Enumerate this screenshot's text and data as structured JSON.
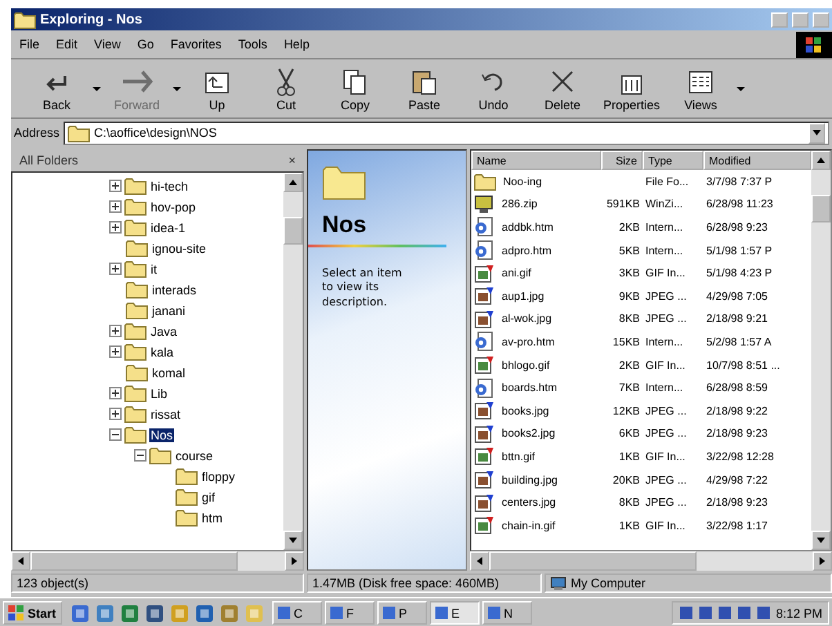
{
  "window": {
    "title": "Exploring - Nos"
  },
  "menu": [
    "File",
    "Edit",
    "View",
    "Go",
    "Favorites",
    "Tools",
    "Help"
  ],
  "toolbar": [
    {
      "label": "Back",
      "kind": "back",
      "disabled": false,
      "dropdown": true
    },
    {
      "label": "Forward",
      "kind": "forward",
      "disabled": true,
      "dropdown": true
    },
    {
      "label": "Up",
      "kind": "up",
      "disabled": false,
      "dropdown": false
    },
    {
      "label": "Cut",
      "kind": "cut",
      "disabled": false,
      "dropdown": false
    },
    {
      "label": "Copy",
      "kind": "copy",
      "disabled": false,
      "dropdown": false
    },
    {
      "label": "Paste",
      "kind": "paste",
      "disabled": false,
      "dropdown": false
    },
    {
      "label": "Undo",
      "kind": "undo",
      "disabled": false,
      "dropdown": false
    },
    {
      "label": "Delete",
      "kind": "delete",
      "disabled": false,
      "dropdown": false
    },
    {
      "label": "Properties",
      "kind": "properties",
      "disabled": false,
      "dropdown": false
    },
    {
      "label": "Views",
      "kind": "views",
      "disabled": false,
      "dropdown": true
    }
  ],
  "address": {
    "label": "Address",
    "value": "C:\\aoffice\\design\\NOS"
  },
  "folder_pane": {
    "title": "All Folders",
    "close": "×"
  },
  "tree": [
    {
      "label": "hi-tech",
      "expandable": true,
      "expanded": false,
      "selected": false
    },
    {
      "label": "hov-pop",
      "expandable": true,
      "expanded": false,
      "selected": false
    },
    {
      "label": "idea-1",
      "expandable": true,
      "expanded": false,
      "selected": false
    },
    {
      "label": "ignou-site",
      "expandable": false,
      "selected": false
    },
    {
      "label": "it",
      "expandable": true,
      "expanded": false,
      "selected": false
    },
    {
      "label": "interads",
      "expandable": false,
      "selected": false
    },
    {
      "label": "janani",
      "expandable": false,
      "selected": false
    },
    {
      "label": "Java",
      "expandable": true,
      "expanded": false,
      "selected": false
    },
    {
      "label": "kala",
      "expandable": true,
      "expanded": false,
      "selected": false
    },
    {
      "label": "komal",
      "expandable": false,
      "selected": false
    },
    {
      "label": "Lib",
      "expandable": true,
      "expanded": false,
      "selected": false
    },
    {
      "label": "rissat",
      "expandable": true,
      "expanded": false,
      "selected": false
    },
    {
      "label": "Nos",
      "expandable": true,
      "expanded": true,
      "selected": true,
      "children": [
        {
          "label": "course",
          "expandable": true,
          "expanded": true,
          "selected": false,
          "children": [
            {
              "label": "floppy",
              "expandable": false,
              "selected": false
            },
            {
              "label": "gif",
              "expandable": false,
              "selected": false
            },
            {
              "label": "htm",
              "expandable": false,
              "selected": false
            }
          ]
        }
      ]
    }
  ],
  "web_view": {
    "title": "Nos",
    "description": "Select an item to view its description."
  },
  "file_list": {
    "columns": [
      "Name",
      "Size",
      "Type",
      "Modified"
    ],
    "rows": [
      {
        "kind": "folder",
        "name": "Noo-ing",
        "size": "",
        "type": "File Fo...",
        "modified": "3/7/98 7:37 P"
      },
      {
        "kind": "zip",
        "name": "286.zip",
        "size": "591KB",
        "type": "WinZi...",
        "modified": "6/28/98 11:23"
      },
      {
        "kind": "html",
        "name": "addbk.htm",
        "size": "2KB",
        "type": "Intern...",
        "modified": "6/28/98 9:23"
      },
      {
        "kind": "html",
        "name": "adpro.htm",
        "size": "5KB",
        "type": "Intern...",
        "modified": "5/1/98 1:57 P"
      },
      {
        "kind": "gif",
        "name": "ani.gif",
        "size": "3KB",
        "type": "GIF In...",
        "modified": "5/1/98 4:23 P"
      },
      {
        "kind": "jpg",
        "name": "aup1.jpg",
        "size": "9KB",
        "type": "JPEG ...",
        "modified": "4/29/98 7:05"
      },
      {
        "kind": "jpg",
        "name": "al-wok.jpg",
        "size": "8KB",
        "type": "JPEG ...",
        "modified": "2/18/98 9:21"
      },
      {
        "kind": "html",
        "name": "av-pro.htm",
        "size": "15KB",
        "type": "Intern...",
        "modified": "5/2/98 1:57 A"
      },
      {
        "kind": "gif",
        "name": "bhlogo.gif",
        "size": "2KB",
        "type": "GIF In...",
        "modified": "10/7/98 8:51 ..."
      },
      {
        "kind": "html",
        "name": "boards.htm",
        "size": "7KB",
        "type": "Intern...",
        "modified": "6/28/98 8:59"
      },
      {
        "kind": "jpg",
        "name": "books.jpg",
        "size": "12KB",
        "type": "JPEG ...",
        "modified": "2/18/98 9:22"
      },
      {
        "kind": "jpg",
        "name": "books2.jpg",
        "size": "6KB",
        "type": "JPEG ...",
        "modified": "2/18/98 9:23"
      },
      {
        "kind": "gif",
        "name": "bttn.gif",
        "size": "1KB",
        "type": "GIF In...",
        "modified": "3/22/98 12:28"
      },
      {
        "kind": "jpg",
        "name": "building.jpg",
        "size": "20KB",
        "type": "JPEG ...",
        "modified": "4/29/98 7:22"
      },
      {
        "kind": "jpg",
        "name": "centers.jpg",
        "size": "8KB",
        "type": "JPEG ...",
        "modified": "2/18/98 9:23"
      },
      {
        "kind": "gif",
        "name": "chain-in.gif",
        "size": "1KB",
        "type": "GIF In...",
        "modified": "3/22/98 1:17"
      }
    ]
  },
  "status_bar": {
    "objects": "123 object(s)",
    "disk": "1.47MB (Disk free space: 460MB)",
    "location": "My Computer"
  },
  "taskbar": {
    "start": "Start",
    "quick_launch": [
      {
        "kind": "browser"
      },
      {
        "kind": "desktop"
      },
      {
        "kind": "save"
      },
      {
        "kind": "grid"
      },
      {
        "kind": "compass"
      },
      {
        "kind": "monitor"
      },
      {
        "kind": "tools"
      },
      {
        "kind": "folder"
      }
    ],
    "tasks": [
      {
        "label": "C",
        "selected": false
      },
      {
        "label": "F",
        "selected": false
      },
      {
        "label": "P",
        "selected": false
      },
      {
        "label": "E",
        "selected": true
      },
      {
        "label": "N",
        "selected": false
      }
    ],
    "clock": "8:12 PM"
  }
}
